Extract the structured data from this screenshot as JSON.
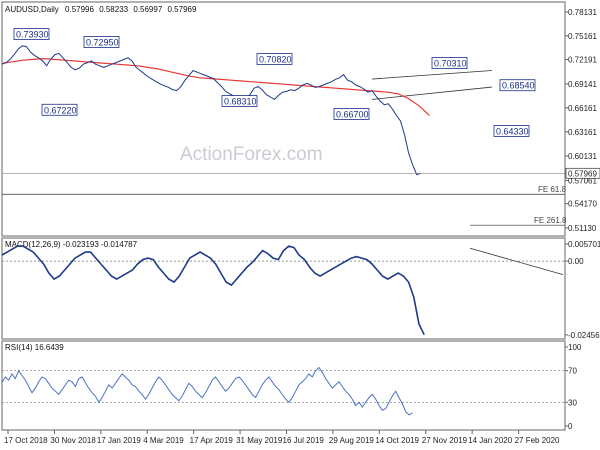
{
  "chart_data": [
    {
      "type": "line",
      "panel": "price",
      "title": "AUDUSD,Daily",
      "ohlc": [
        "0.57996",
        "0.58233",
        "0.56997",
        "0.57969"
      ],
      "y_ticks": [
        "0.78131",
        "0.75161",
        "0.72191",
        "0.69141",
        "0.66161",
        "0.63161",
        "0.60131",
        "0.57061",
        "0.54170",
        "0.51130"
      ],
      "ylim": [
        0.5113,
        0.7813
      ],
      "x_ticks": [
        "17 Oct 2018",
        "30 Nov 2018",
        "17 Jan 2019",
        "4 Mar 2019",
        "17 Apr 2019",
        "31 May 2019",
        "16 Jul 2019",
        "29 Aug 2019",
        "14 Oct 2019",
        "27 Nov 2019",
        "14 Jan 2020",
        "27 Feb 2020"
      ],
      "current_price_label": "0.57969",
      "current_price": 0.57969,
      "series": [
        {
          "key": "price",
          "color": "#1e3a8a",
          "values": [
            0.716,
            0.718,
            0.722,
            0.728,
            0.735,
            0.739,
            0.738,
            0.731,
            0.727,
            0.724,
            0.72,
            0.714,
            0.7225,
            0.728,
            0.7295,
            0.724,
            0.718,
            0.712,
            0.709,
            0.711,
            0.716,
            0.718,
            0.72,
            0.716,
            0.714,
            0.712,
            0.714,
            0.716,
            0.718,
            0.72,
            0.722,
            0.724,
            0.72,
            0.712,
            0.708,
            0.704,
            0.7,
            0.697,
            0.694,
            0.691,
            0.689,
            0.687,
            0.684,
            0.6831,
            0.688,
            0.696,
            0.702,
            0.708,
            0.706,
            0.704,
            0.702,
            0.7,
            0.698,
            0.693,
            0.688,
            0.682,
            0.679,
            0.676,
            0.674,
            0.672,
            0.674,
            0.678,
            0.686,
            0.688,
            0.684,
            0.678,
            0.675,
            0.672,
            0.677,
            0.681,
            0.682,
            0.684,
            0.683,
            0.686,
            0.69,
            0.692,
            0.69,
            0.687,
            0.688,
            0.69,
            0.692,
            0.694,
            0.697,
            0.699,
            0.7031,
            0.696,
            0.694,
            0.69,
            0.688,
            0.685,
            0.681,
            0.683,
            0.676,
            0.67,
            0.6654,
            0.6665,
            0.66,
            0.652,
            0.645,
            0.628,
            0.605,
            0.59,
            0.578,
            0.5797
          ],
          "x_start": 0,
          "x_step": 3.9
        },
        {
          "key": "sma",
          "color": "#e53935",
          "values": [
            0.717,
            0.719,
            0.721,
            0.722,
            0.723,
            0.722,
            0.721,
            0.72,
            0.719,
            0.718,
            0.717,
            0.716,
            0.715,
            0.714,
            0.712,
            0.71,
            0.707,
            0.704,
            0.701,
            0.699,
            0.698,
            0.697,
            0.696,
            0.695,
            0.694,
            0.693,
            0.692,
            0.691,
            0.69,
            0.689,
            0.688,
            0.687,
            0.686,
            0.685,
            0.684,
            0.683,
            0.682,
            0.681,
            0.679,
            0.673,
            0.664,
            0.652
          ],
          "x_start": 0,
          "x_step": 10
        },
        {
          "key": "macd",
          "color": "#1e3a8a",
          "values": [
            0.002,
            0.003,
            0.004,
            0.005,
            0.005,
            0.004,
            0.003,
            0.001,
            -0.001,
            -0.004,
            -0.006,
            -0.005,
            -0.003,
            -0.001,
            0.001,
            0.002,
            0.003,
            0.003,
            0.001,
            -0.001,
            -0.003,
            -0.005,
            -0.006,
            -0.005,
            -0.004,
            -0.003,
            -0.001,
            0.0005,
            0.001,
            0.0005,
            -0.002,
            -0.004,
            -0.006,
            -0.007,
            -0.005,
            -0.002,
            0.001,
            0.002,
            0.003,
            0.002,
            0.001,
            -0.001,
            -0.004,
            -0.007,
            -0.008,
            -0.006,
            -0.004,
            -0.002,
            -0.0005,
            0.0015,
            0.0035,
            0.0025,
            0.001,
            0.0005,
            0.0035,
            0.005,
            0.0045,
            0.002,
            0.0005,
            -0.002,
            -0.004,
            -0.005,
            -0.004,
            -0.003,
            -0.002,
            -0.001,
            0,
            0.001,
            0.0015,
            0.001,
            0.0005,
            -0.001,
            -0.003,
            -0.005,
            -0.006,
            -0.005,
            -0.004,
            -0.005,
            -0.007,
            -0.012,
            -0.021,
            -0.0245
          ],
          "x_start": 0,
          "x_step": 5
        },
        {
          "key": "rsi",
          "color": "#4a72c4",
          "values": [
            55,
            62,
            58,
            66,
            60,
            70,
            64,
            58,
            50,
            42,
            48,
            56,
            62,
            60,
            54,
            48,
            44,
            40,
            46,
            52,
            58,
            56,
            50,
            60,
            62,
            55,
            48,
            42,
            38,
            30,
            36,
            44,
            52,
            48,
            54,
            60,
            66,
            62,
            58,
            52,
            50,
            44,
            40,
            34,
            40,
            48,
            56,
            62,
            58,
            52,
            46,
            40,
            36,
            32,
            38,
            46,
            54,
            50,
            44,
            40,
            36,
            42,
            50,
            58,
            62,
            56,
            50,
            44,
            48,
            54,
            60,
            62,
            58,
            52,
            46,
            40,
            36,
            44,
            52,
            58,
            62,
            56,
            50,
            46,
            40,
            34,
            30,
            36,
            44,
            52,
            56,
            60,
            66,
            62,
            70,
            74,
            68,
            60,
            54,
            48,
            52,
            56,
            50,
            44,
            40,
            34,
            26,
            30,
            24,
            30,
            36,
            40,
            34,
            26,
            20,
            22,
            30,
            38,
            44,
            36,
            28,
            18,
            14,
            16.6
          ],
          "x_start": 0,
          "x_step": 3.2
        }
      ],
      "annotations": [
        {
          "label": "0.73930",
          "value": 0.7393
        },
        {
          "label": "0.72950",
          "value": 0.7295
        },
        {
          "label": "0.67220",
          "value": 0.6722
        },
        {
          "label": "0.68310",
          "value": 0.6831
        },
        {
          "label": "0.70820",
          "value": 0.7082
        },
        {
          "label": "0.66700",
          "value": 0.667
        },
        {
          "label": "0.70310",
          "value": 0.7031
        },
        {
          "label": "0.68540",
          "value": 0.6854
        },
        {
          "label": "0.64330",
          "value": 0.6433
        }
      ],
      "fe_levels": [
        {
          "label": "FE 61.8",
          "value": 0.5535
        },
        {
          "label": "FE 261.8",
          "value": 0.5148
        }
      ]
    },
    {
      "type": "line",
      "panel": "macd",
      "title": "MACD(12,26,9) -0.023193 -0.014787",
      "y_ticks": [
        "0.005701",
        "0.00",
        "-0.024569"
      ],
      "ylim": [
        -0.0246,
        0.0057
      ]
    },
    {
      "type": "line",
      "panel": "rsi",
      "title": "RSI(14) 16.6439",
      "y_ticks": [
        "100",
        "70",
        "30",
        "0"
      ],
      "ylim": [
        0,
        100
      ],
      "levels": [
        70,
        30
      ]
    }
  ],
  "watermark": "ActionForex.com",
  "colors": {
    "price": "#1e3a8a",
    "sma": "#e53935",
    "channel": "#333333",
    "annotation_text": "#1a2f8c",
    "grid": "#7a7a7a"
  }
}
